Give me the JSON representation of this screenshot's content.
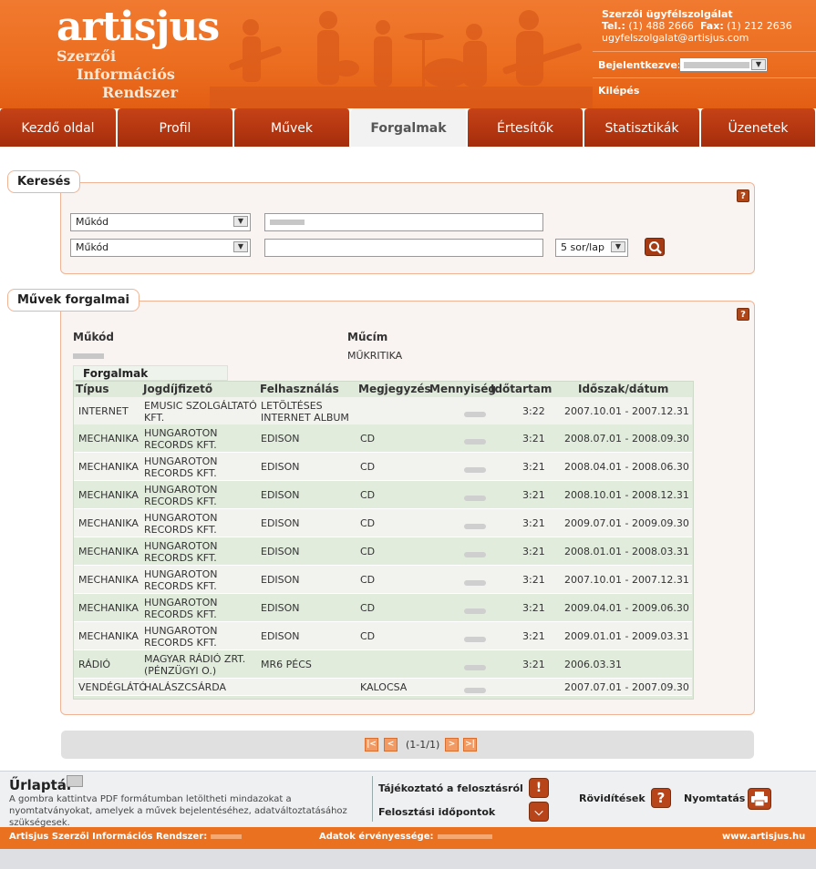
{
  "header": {
    "logo": "artisjus",
    "logo_sub": [
      "Szerzői",
      "Információs",
      "Rendszer"
    ],
    "contact_title": "Szerzői ügyfélszolgálat",
    "tel_label": "Tel.:",
    "tel": "(1) 488 2666",
    "fax_label": "Fax:",
    "fax": "(1) 212 2636",
    "email": "ugyfelszolgalat@artisjus.com",
    "login_label": "Bejelentkezve:",
    "logout": "Kilépés"
  },
  "nav": {
    "tabs": [
      "Kezdő oldal",
      "Profil",
      "Művek",
      "Forgalmak",
      "Értesítők",
      "Statisztikák",
      "Üzenetek"
    ],
    "active": "Forgalmak"
  },
  "search": {
    "title": "Keresés",
    "field1_select": "Műkód",
    "field2_select": "Műkód",
    "per_page": "5 sor/lap",
    "help": "?"
  },
  "results": {
    "title": "Művek forgalmai",
    "help": "?",
    "mukod_label": "Műkód",
    "mucim_label": "Műcím",
    "mucim_value": "MŰKRITIKA",
    "subtab": "Forgalmak",
    "columns": [
      "Típus",
      "Jogdíjfizető",
      "Felhasználás",
      "Megjegyzés",
      "Mennyiség",
      "Időtartam",
      "Időszak/dátum"
    ],
    "rows": [
      {
        "tipus": "INTERNET",
        "jog": [
          "EMUSIC SZOLGÁLTATÓ",
          "KFT."
        ],
        "felh": [
          "LETÖLTÉSES",
          "INTERNET ALBUM"
        ],
        "megj": "",
        "ido": "3:22",
        "idoszak": "2007.10.01 - 2007.12.31"
      },
      {
        "tipus": "MECHANIKA",
        "jog": [
          "HUNGAROTON",
          "RECORDS KFT."
        ],
        "felh": [
          "EDISON",
          ""
        ],
        "megj": "CD",
        "ido": "3:21",
        "idoszak": "2008.07.01 - 2008.09.30"
      },
      {
        "tipus": "MECHANIKA",
        "jog": [
          "HUNGAROTON",
          "RECORDS KFT."
        ],
        "felh": [
          "EDISON",
          ""
        ],
        "megj": "CD",
        "ido": "3:21",
        "idoszak": "2008.04.01 - 2008.06.30"
      },
      {
        "tipus": "MECHANIKA",
        "jog": [
          "HUNGAROTON",
          "RECORDS KFT."
        ],
        "felh": [
          "EDISON",
          ""
        ],
        "megj": "CD",
        "ido": "3:21",
        "idoszak": "2008.10.01 - 2008.12.31"
      },
      {
        "tipus": "MECHANIKA",
        "jog": [
          "HUNGAROTON",
          "RECORDS KFT."
        ],
        "felh": [
          "EDISON",
          ""
        ],
        "megj": "CD",
        "ido": "3:21",
        "idoszak": "2009.07.01 - 2009.09.30"
      },
      {
        "tipus": "MECHANIKA",
        "jog": [
          "HUNGAROTON",
          "RECORDS KFT."
        ],
        "felh": [
          "EDISON",
          ""
        ],
        "megj": "CD",
        "ido": "3:21",
        "idoszak": "2008.01.01 - 2008.03.31"
      },
      {
        "tipus": "MECHANIKA",
        "jog": [
          "HUNGAROTON",
          "RECORDS KFT."
        ],
        "felh": [
          "EDISON",
          ""
        ],
        "megj": "CD",
        "ido": "3:21",
        "idoszak": "2007.10.01 - 2007.12.31"
      },
      {
        "tipus": "MECHANIKA",
        "jog": [
          "HUNGAROTON",
          "RECORDS KFT."
        ],
        "felh": [
          "EDISON",
          ""
        ],
        "megj": "CD",
        "ido": "3:21",
        "idoszak": "2009.04.01 - 2009.06.30"
      },
      {
        "tipus": "MECHANIKA",
        "jog": [
          "HUNGAROTON",
          "RECORDS KFT."
        ],
        "felh": [
          "EDISON",
          ""
        ],
        "megj": "CD",
        "ido": "3:21",
        "idoszak": "2009.01.01 - 2009.03.31"
      },
      {
        "tipus": "RÁDIÓ",
        "jog": [
          "MAGYAR RÁDIÓ ZRT.",
          "(PÉNZÜGYI O.)"
        ],
        "felh": [
          "MR6 PÉCS",
          ""
        ],
        "megj": "",
        "ido": "3:21",
        "idoszak": "2006.03.31"
      },
      {
        "tipus": "VENDÉGLÁTÓ",
        "jog": [
          "HALÁSZCSÁRDA",
          ""
        ],
        "felh": [
          "",
          ""
        ],
        "megj": "KALOCSA",
        "ido": "",
        "idoszak": "2007.07.01 - 2007.09.30"
      }
    ]
  },
  "pager": {
    "first": "|<",
    "prev": "<",
    "info": "(1-1/1)",
    "next": ">",
    "last": ">|"
  },
  "footer": {
    "urlap_title": "Űrlaptár",
    "urlap_desc": "A gombra kattintva PDF formátumban letöltheti mindazokat a nyomtatványokat, amelyek a művek bejelentéséhez, adatváltoztatásához szükségesek.",
    "link1": "Tájékoztató a felosztásról",
    "link2": "Felosztási időpontok",
    "link3": "Rövidítések",
    "link4": "Nyomtatás",
    "icon1": "!",
    "icon3": "?"
  },
  "bottom": {
    "left": "Artisjus Szerzői Információs Rendszer:",
    "mid": "Adatok érvényessége:",
    "right": "www.artisjus.hu"
  }
}
